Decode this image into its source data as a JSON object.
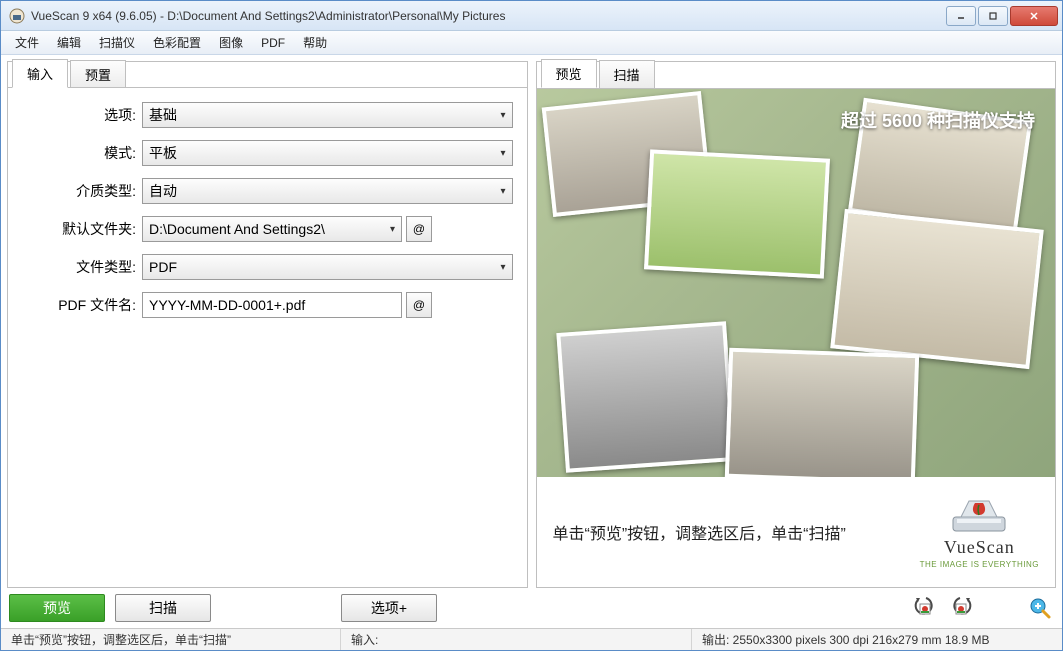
{
  "window": {
    "title": "VueScan 9 x64 (9.6.05) - D:\\Document And Settings2\\Administrator\\Personal\\My Pictures"
  },
  "menu": {
    "items": [
      "文件",
      "编辑",
      "扫描仪",
      "色彩配置",
      "图像",
      "PDF",
      "帮助"
    ]
  },
  "leftPanel": {
    "tabs": [
      "输入",
      "预置"
    ],
    "activeTab": 0,
    "form": {
      "options": {
        "label": "选项:",
        "value": "基础"
      },
      "mode": {
        "label": "模式:",
        "value": "平板"
      },
      "mediaType": {
        "label": "介质类型:",
        "value": "自动"
      },
      "defaultFolder": {
        "label": "默认文件夹:",
        "value": "D:\\Document And Settings2\\"
      },
      "fileType": {
        "label": "文件类型:",
        "value": "PDF"
      },
      "pdfFilename": {
        "label": "PDF 文件名:",
        "value": "YYYY-MM-DD-0001+.pdf"
      },
      "atSymbol": "@"
    }
  },
  "rightPanel": {
    "tabs": [
      "预览",
      "扫描"
    ],
    "activeTab": 0,
    "overlayText": "超过 5600 种扫描仪支持",
    "hint": "单击“预览”按钮，调整选区后，单击“扫描”",
    "brand": {
      "name": "VueScan",
      "tagline": "THE IMAGE IS EVERYTHING"
    }
  },
  "actions": {
    "preview": "预览",
    "scan": "扫描",
    "options": "选项+"
  },
  "statusbar": {
    "left": "单击“预览”按钮，调整选区后，单击“扫描”",
    "midLabel": "输入:",
    "right": "输出: 2550x3300 pixels 300 dpi 216x279 mm 18.9 MB"
  }
}
